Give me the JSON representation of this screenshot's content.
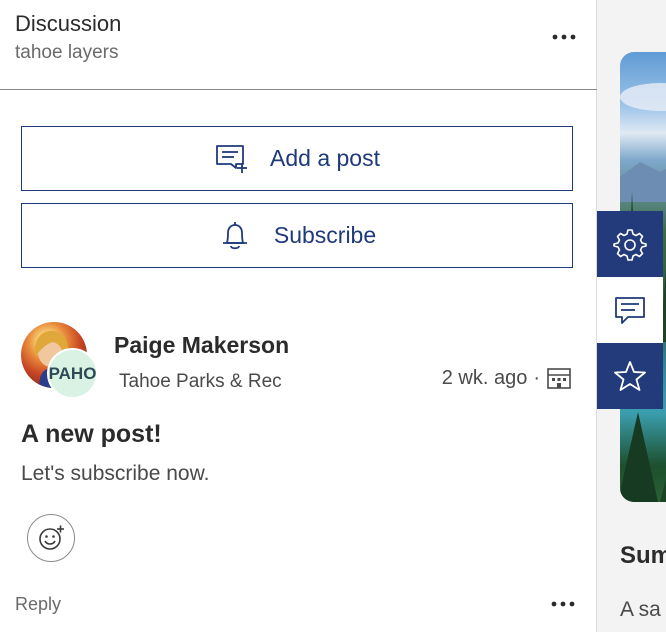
{
  "panel": {
    "title": "Discussion",
    "subtitle": "tahoe layers",
    "more_icon": "more-horizontal-icon"
  },
  "actions": {
    "add_post_label": "Add a post",
    "add_post_icon": "add-comment-icon",
    "subscribe_label": "Subscribe",
    "subscribe_icon": "bell-icon"
  },
  "post": {
    "author_name": "Paige Makerson",
    "org_badge": "PAHO",
    "author_org": "Tahoe Parks & Rec",
    "time_ago": "2 wk. ago",
    "separator": "·",
    "visibility_icon": "organization-building-icon",
    "title": "A new post!",
    "body": "Let's subscribe now.",
    "react_icon": "add-reaction-smiley-icon",
    "reply_label": "Reply"
  },
  "side": {
    "tools": [
      {
        "icon": "gear-icon",
        "active": true
      },
      {
        "icon": "comment-icon",
        "active": false
      },
      {
        "icon": "star-icon",
        "active": true
      }
    ],
    "heading": "Sum",
    "text": "A sa"
  },
  "colors": {
    "accent": "#1f3a7a",
    "tool_bar": "#233b7a",
    "badge_bg": "#d9f2e4"
  }
}
